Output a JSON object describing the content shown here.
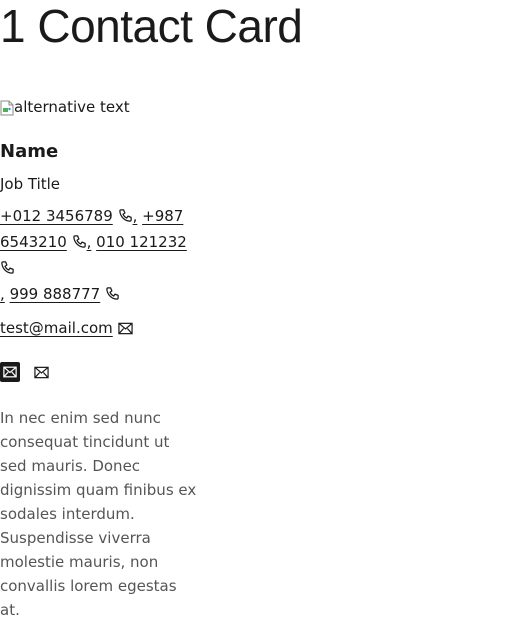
{
  "page": {
    "title": "1 Contact Card"
  },
  "card": {
    "image_alt": "alternative text",
    "name": "Name",
    "job_title": "Job Title",
    "phones": [
      "+012 3456789",
      "+987 6543210",
      "010 121232",
      "999 888777"
    ],
    "phone_separator": ",",
    "phone_icon": "phone-icon",
    "email": "test@mail.com",
    "email_icon": "envelope-icon",
    "social_icons": [
      "envelope-filled-icon",
      "envelope-icon"
    ],
    "description": "In nec enim sed nunc consequat tincidunt ut sed mauris. Donec dignissim quam finibus ex sodales interdum. Suspendisse viverra molestie mauris, non convallis lorem egestas at."
  }
}
